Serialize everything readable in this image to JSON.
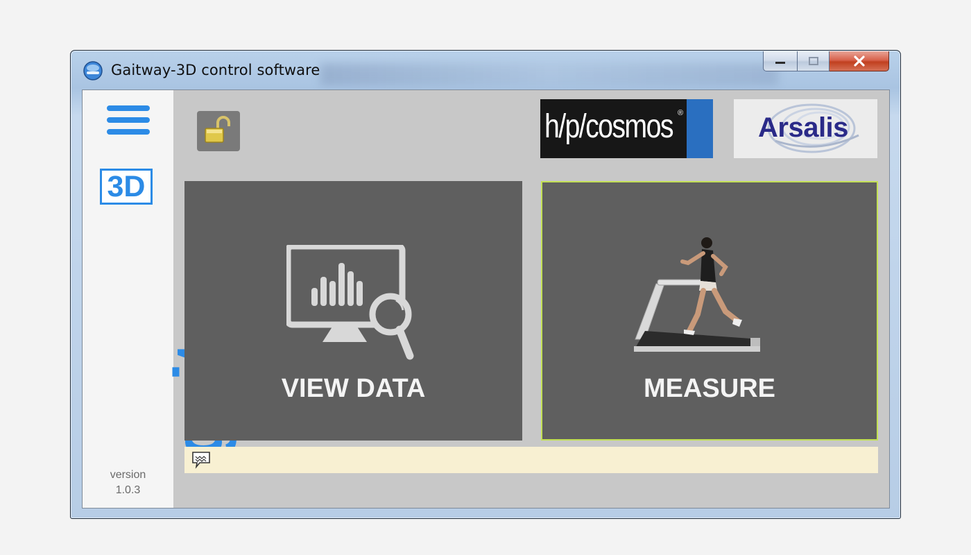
{
  "window": {
    "title": "Gaitway-3D  control software",
    "controls": {
      "minimize": "minimize",
      "maximize": "maximize",
      "close": "close"
    }
  },
  "sidebar": {
    "brand_3d": "3D",
    "brand_word": "gaitway",
    "version_label": "version",
    "version_number": "1.0.3",
    "menu_icon": "hamburger-menu-icon"
  },
  "toolbar": {
    "lock_icon": "unlocked-padlock-icon"
  },
  "logos": {
    "hpcosmos": "h/p/cosmos",
    "hpcosmos_reg": "®",
    "arsalis": "Arsalis"
  },
  "tiles": {
    "view_data": {
      "label": "VIEW DATA",
      "icon": "monitor-chart-magnifier-icon"
    },
    "measure": {
      "label": "MEASURE",
      "icon": "treadmill-runner-image"
    }
  },
  "status_bar": {
    "icon": "message-icon",
    "text": ""
  },
  "colors": {
    "brand_blue": "#2c8be6",
    "tile_bg": "#5f5f5f",
    "selected_border": "#c2e054",
    "status_bg": "#f8f0d2"
  }
}
